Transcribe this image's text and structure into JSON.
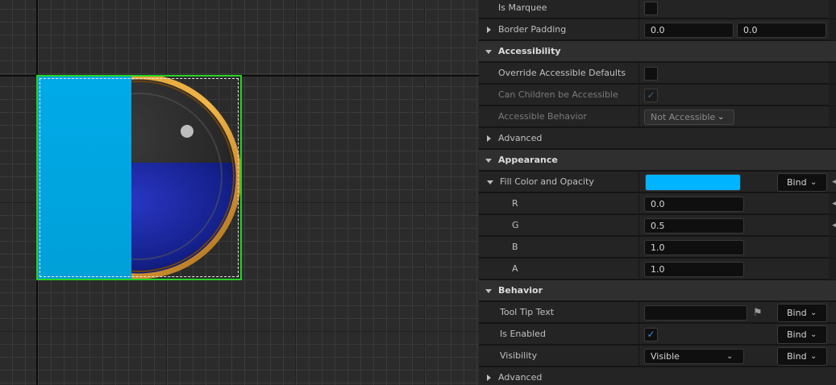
{
  "canvas": {
    "selection_color": "#27d027",
    "fill_color": "#00a6e2"
  },
  "details": {
    "is_marquee": {
      "label": "Is Marquee",
      "checked": false
    },
    "border_padding": {
      "label": "Border Padding",
      "x": "0.0",
      "y": "0.0"
    },
    "accessibility": {
      "title": "Accessibility",
      "override": {
        "label": "Override Accessible Defaults",
        "checked": false
      },
      "can_children": {
        "label": "Can Children be Accessible",
        "checked": true,
        "enabled": false
      },
      "behavior": {
        "label": "Accessible Behavior",
        "value": "Not Accessible",
        "enabled": false
      },
      "advanced": "Advanced"
    },
    "appearance": {
      "title": "Appearance",
      "fill": {
        "label": "Fill Color and Opacity",
        "color": "#00b4ff",
        "bind": "Bind",
        "r_label": "R",
        "r": "0.0",
        "g_label": "G",
        "g": "0.5",
        "b_label": "B",
        "b": "1.0",
        "a_label": "A",
        "a": "1.0"
      }
    },
    "behavior": {
      "title": "Behavior",
      "tooltip": {
        "label": "Tool Tip Text",
        "value": "",
        "bind": "Bind"
      },
      "is_enabled": {
        "label": "Is Enabled",
        "checked": true,
        "bind": "Bind"
      },
      "visibility": {
        "label": "Visibility",
        "value": "Visible",
        "bind": "Bind"
      },
      "advanced": "Advanced"
    }
  },
  "icons": {
    "expand": "triangle-down",
    "collapsed": "triangle-right",
    "check": "checkmark",
    "chevron": "chevron-down",
    "flag": "flag",
    "reset": "reset-arrow"
  }
}
